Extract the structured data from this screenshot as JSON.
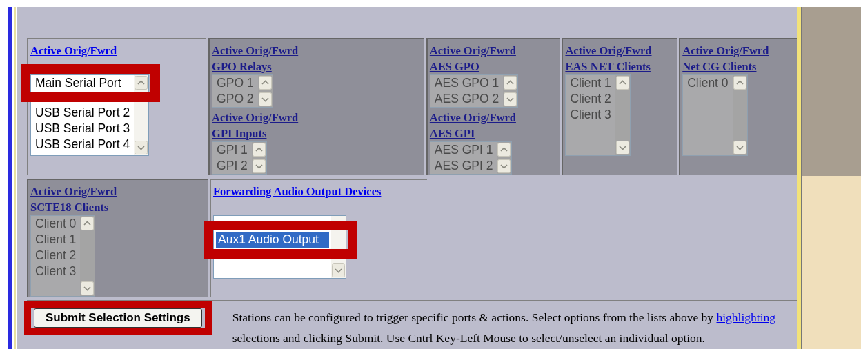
{
  "top_row": [
    {
      "dimmed": false,
      "groups": [
        {
          "heading": [
            "Active Orig/Fwrd"
          ],
          "list": {
            "kind": "tall",
            "items": [
              {
                "label": "Main Serial Port",
                "selected": false,
                "highlighted": true
              },
              {
                "label": "USB Serial Port 2",
                "selected": false,
                "highlighted": false
              },
              {
                "label": "USB Serial Port 3",
                "selected": false,
                "highlighted": false
              },
              {
                "label": "USB Serial Port 4",
                "selected": false,
                "highlighted": false
              }
            ]
          }
        }
      ]
    },
    {
      "dimmed": true,
      "groups": [
        {
          "heading": [
            "Active Orig/Fwrd",
            "GPO Relays"
          ],
          "list": {
            "kind": "compact",
            "items": [
              {
                "label": "GPO 1",
                "selected": false,
                "highlighted": false
              },
              {
                "label": "GPO 2",
                "selected": false,
                "highlighted": false
              }
            ]
          }
        },
        {
          "heading": [
            "Active Orig/Fwrd",
            "GPI Inputs"
          ],
          "list": {
            "kind": "compact",
            "items": [
              {
                "label": "GPI 1",
                "selected": false,
                "highlighted": false
              },
              {
                "label": "GPI 2",
                "selected": false,
                "highlighted": false
              }
            ]
          }
        }
      ]
    },
    {
      "dimmed": true,
      "groups": [
        {
          "heading": [
            "Active Orig/Fwrd",
            "AES GPO"
          ],
          "list": {
            "kind": "compact",
            "items": [
              {
                "label": "AES GPO 1",
                "selected": false,
                "highlighted": false
              },
              {
                "label": "AES GPO 2",
                "selected": false,
                "highlighted": false
              }
            ]
          }
        },
        {
          "heading": [
            "Active Orig/Fwrd",
            "AES GPI"
          ],
          "list": {
            "kind": "compact",
            "items": [
              {
                "label": "AES GPI 1",
                "selected": false,
                "highlighted": false
              },
              {
                "label": "AES GPI 2",
                "selected": false,
                "highlighted": false
              }
            ]
          }
        }
      ]
    },
    {
      "dimmed": true,
      "groups": [
        {
          "heading": [
            "Active Orig/Fwrd",
            "EAS NET Clients"
          ],
          "list": {
            "kind": "tall",
            "items": [
              {
                "label": "Client 1",
                "selected": false,
                "highlighted": false
              },
              {
                "label": "Client 2",
                "selected": false,
                "highlighted": false
              },
              {
                "label": "Client 3",
                "selected": false,
                "highlighted": false
              }
            ]
          }
        }
      ]
    },
    {
      "dimmed": true,
      "groups": [
        {
          "heading": [
            "Active Orig/Fwrd",
            "Net CG Clients"
          ],
          "list": {
            "kind": "tall",
            "items": [
              {
                "label": "Client 0",
                "selected": false,
                "highlighted": false
              }
            ]
          }
        }
      ]
    }
  ],
  "bottom_row": [
    {
      "dimmed": true,
      "groups": [
        {
          "heading": [
            "Active Orig/Fwrd",
            "SCTE18 Clients"
          ],
          "list": {
            "kind": "tall",
            "items": [
              {
                "label": "Client 0",
                "selected": false,
                "highlighted": false
              },
              {
                "label": "Client 1",
                "selected": false,
                "highlighted": false
              },
              {
                "label": "Client 2",
                "selected": false,
                "highlighted": false
              },
              {
                "label": "Client 3",
                "selected": false,
                "highlighted": false
              }
            ]
          }
        }
      ]
    },
    {
      "dimmed": false,
      "groups": [
        {
          "heading": [
            "Forwarding Audio Output Devices"
          ],
          "list": {
            "kind": "wide",
            "items": [
              {
                "label": "Aux1 Audio Output",
                "selected": true,
                "highlighted": true
              }
            ]
          }
        }
      ]
    }
  ],
  "side_strip": {
    "dimmed": true
  },
  "footer": {
    "button": {
      "label": "Submit Selection Settings",
      "highlighted": true
    },
    "text_before": "Stations can be configured to trigger specific ports & actions. Select options from the lists above by ",
    "link": "highlighting",
    "text_after": " selections and clicking Submit. Use Cntrl Key-Left Mouse to select/unselect an individual option."
  }
}
